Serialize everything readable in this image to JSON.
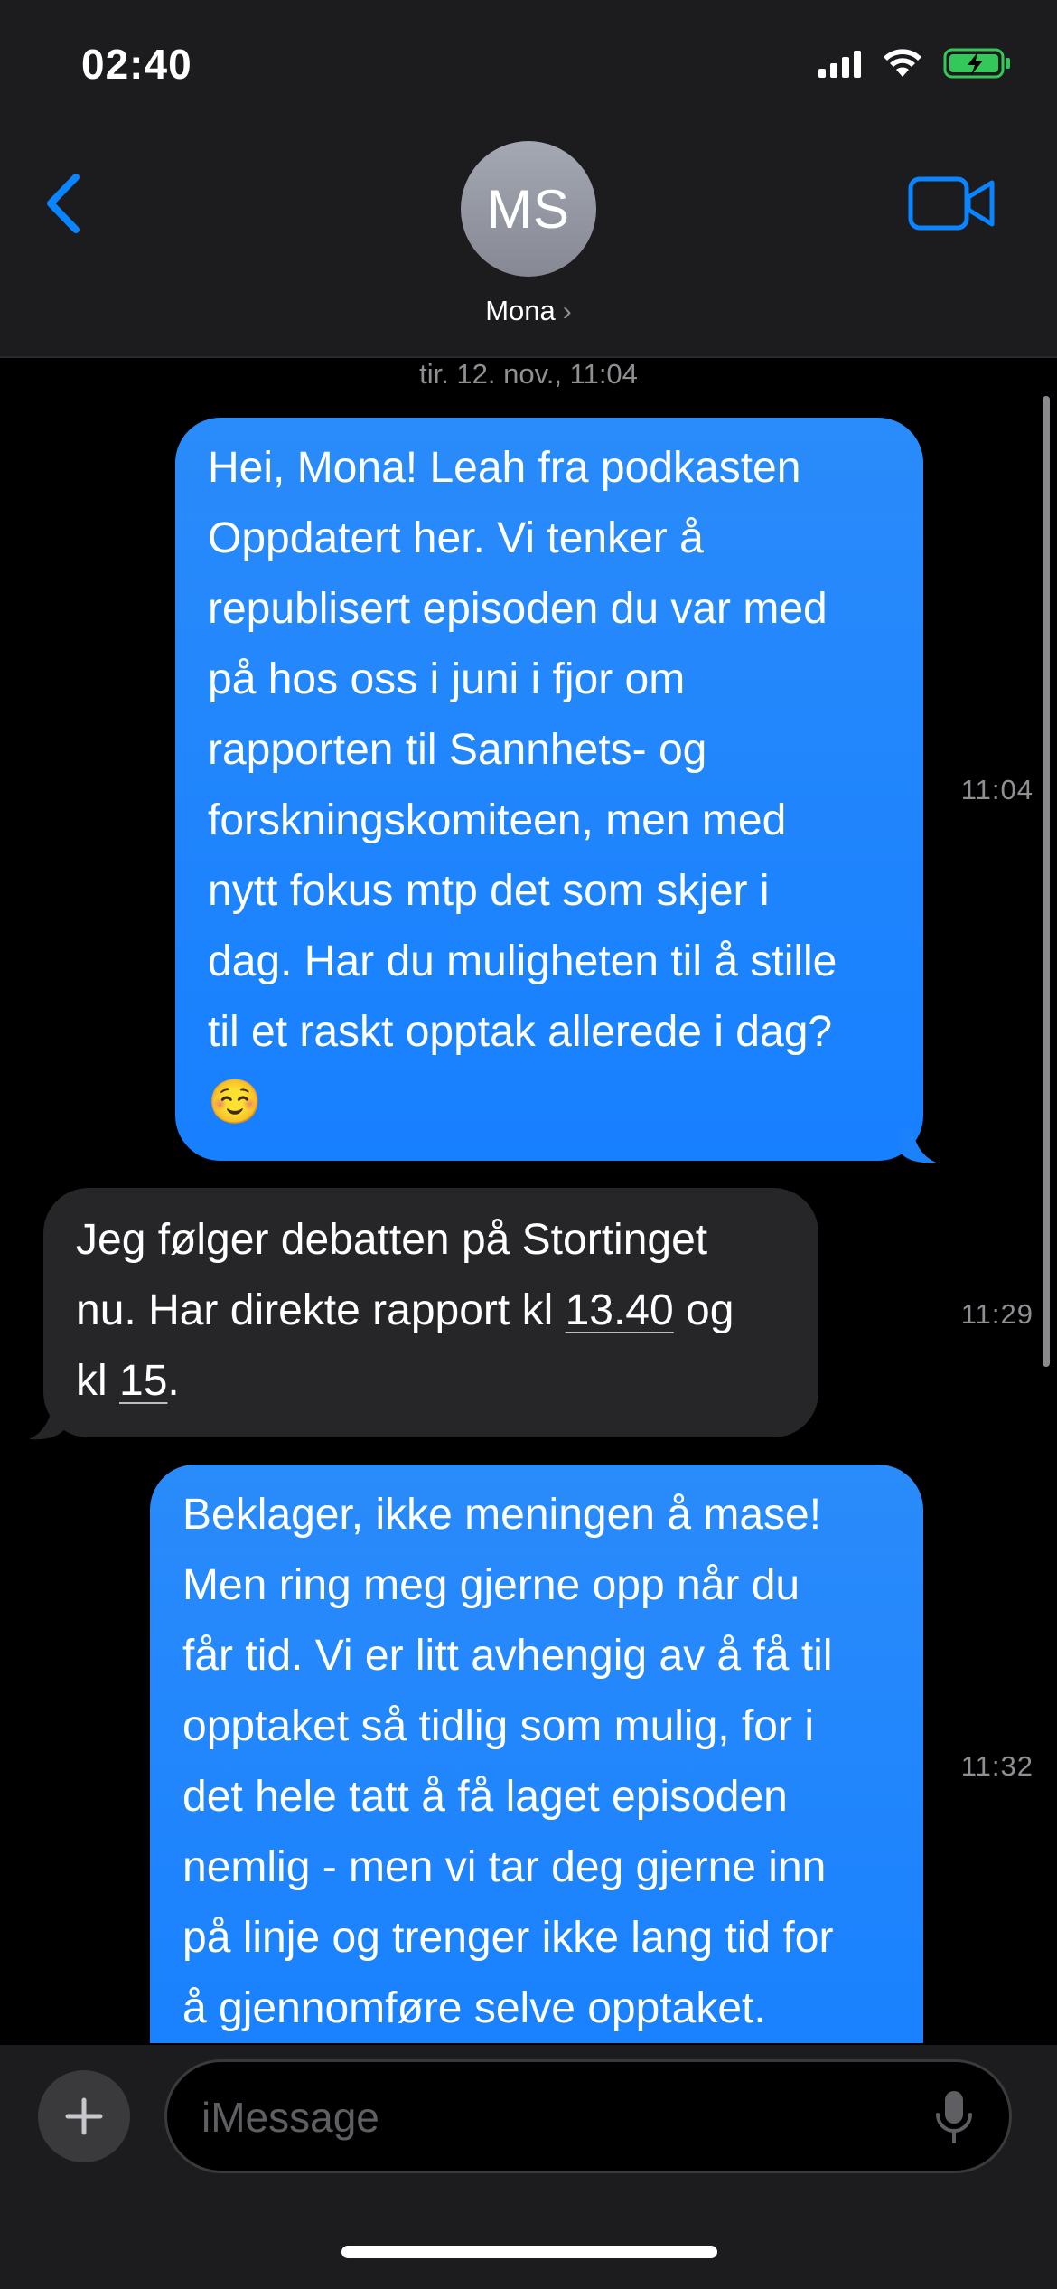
{
  "status_bar": {
    "time": "02:40",
    "icons": [
      "cellular-signal-icon",
      "wifi-icon",
      "battery-charging-icon"
    ]
  },
  "header": {
    "avatar_initials": "MS",
    "contact_name": "Mona",
    "chevron": "›",
    "icons": [
      "back-chevron-icon",
      "video-camera-icon"
    ]
  },
  "conversation": {
    "date_header": "tir. 12. nov., 11:04",
    "messages": [
      {
        "direction": "sent",
        "time": "11:04",
        "lines": [
          "Hei, Mona! Leah fra podkasten",
          "Oppdatert her. Vi tenker å",
          "republisert episoden du var med",
          "på hos oss i juni i fjor om",
          "rapporten til Sannhets- og",
          "forskningskomiteen, men med",
          "nytt fokus mtp det som skjer i",
          "dag. Har du muligheten til å stille",
          "til et raskt opptak allerede i dag?",
          "☺️"
        ]
      },
      {
        "direction": "received",
        "time": "11:29",
        "line1": "Jeg følger debatten på Stortinget",
        "line2_pre": "nu. Har direkte rapport kl ",
        "line2_link": "13.40",
        "line2_post": " og",
        "line3_pre": "kl ",
        "line3_link": "15",
        "line3_post": "."
      },
      {
        "direction": "sent",
        "time": "11:32",
        "lines": [
          "Beklager, ikke meningen å mase!",
          "Men ring meg gjerne opp når du",
          "får tid. Vi er litt avhengig av å få til",
          "opptaket så tidlig som mulig, for i",
          "det hele tatt å få laget episoden",
          "nemlig - men vi tar deg gjerne inn",
          "på linje og trenger ikke lang tid for",
          "å gjennomføre selve opptaket."
        ]
      }
    ]
  },
  "input_bar": {
    "placeholder": "iMessage",
    "value": "",
    "icons": [
      "plus-icon",
      "microphone-icon"
    ]
  },
  "colors": {
    "accent": "#0a84ff",
    "sent_bubble": "#1c82fc",
    "received_bubble": "#262628",
    "header_bg": "#1c1c1e",
    "battery_green": "#34c759",
    "secondary_text": "#8e8e93"
  }
}
